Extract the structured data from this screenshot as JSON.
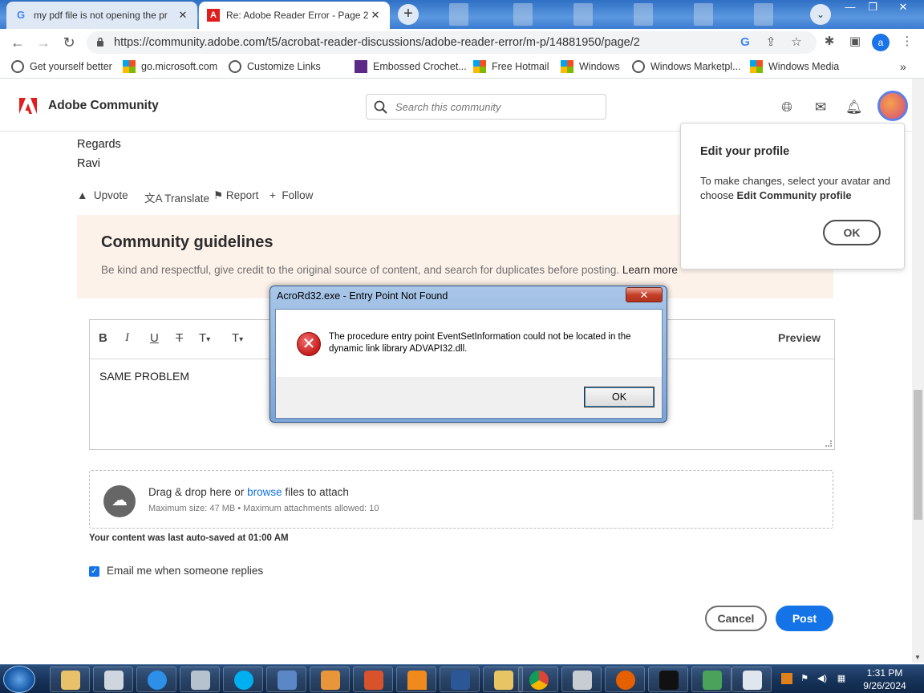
{
  "browser": {
    "tabs": [
      {
        "title": "my pdf file is not opening the pr",
        "close": "✕"
      },
      {
        "title": "Re: Adobe Reader Error - Page 2",
        "close": "✕"
      }
    ],
    "new_tab": "+",
    "tab_search": "⌄",
    "window_buttons": {
      "minimize": "—",
      "restore": "❐",
      "close": "✕"
    },
    "url": "https://community.adobe.com/t5/acrobat-reader-discussions/adobe-reader-error/m-p/14881950/page/2",
    "profile_initial": "a",
    "bookmarks": [
      {
        "label": "Get yourself better",
        "icon": "globe-icon"
      },
      {
        "label": "go.microsoft.com",
        "icon": "microsoft-icon"
      },
      {
        "label": "Customize Links",
        "icon": "globe-icon"
      },
      {
        "label": "Embossed Crochet...",
        "icon": "yarn-icon"
      },
      {
        "label": "Free Hotmail",
        "icon": "microsoft-icon"
      },
      {
        "label": "Windows",
        "icon": "microsoft-icon"
      },
      {
        "label": "Windows Marketpl...",
        "icon": "globe-icon"
      },
      {
        "label": "Windows Media",
        "icon": "microsoft-icon"
      }
    ],
    "bookmarks_more": "»"
  },
  "site": {
    "brand": "Adobe Community",
    "search_placeholder": "Search this community"
  },
  "post": {
    "regards": "Regards",
    "author_sign": "Ravi",
    "actions": {
      "upvote": "Upvote",
      "translate": "Translate",
      "report": "Report",
      "follow": "Follow"
    }
  },
  "guidelines": {
    "title": "Community guidelines",
    "text": "Be kind and respectful, give credit to the original source of content, and search for duplicates before posting.",
    "link": "Learn more"
  },
  "editor": {
    "buttons": {
      "bold": "B",
      "italic": "I",
      "underline": "U",
      "strikethrough": "T",
      "font_size": "T",
      "format": "T"
    },
    "preview": "Preview",
    "content": "SAME PROBLEM"
  },
  "attach": {
    "prefix": "Drag & drop here or",
    "link": "browse",
    "suffix": "files to attach",
    "limits": "Maximum size: 47 MB • Maximum attachments allowed: 10"
  },
  "autosave": "Your content was last auto-saved at 01:00 AM",
  "email_opt": {
    "label": "Email me when someone replies",
    "checked": true
  },
  "buttons": {
    "cancel": "Cancel",
    "post": "Post"
  },
  "popover": {
    "title": "Edit your profile",
    "text_line1": "To make changes, select your avatar and",
    "text_line2_prefix": "choose",
    "text_line2_bold": "Edit Community profile",
    "ok": "OK"
  },
  "dialog": {
    "title": "AcroRd32.exe - Entry Point Not Found",
    "close": "✕",
    "message": "The procedure entry point EventSetInformation could not be located in the dynamic link library ADVAPI32.dll.",
    "ok": "OK"
  },
  "taskbar": {
    "time": "1:31 PM",
    "date": "9/26/2024"
  },
  "colors": {
    "accent": "#1473e6",
    "guidelines_bg": "#fdf2ea",
    "adobe_red": "#e01e1e"
  }
}
